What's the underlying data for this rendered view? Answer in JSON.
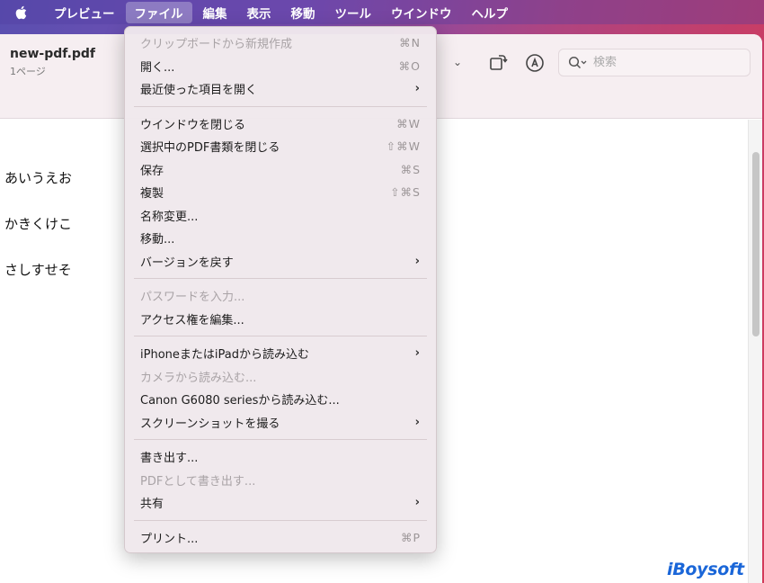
{
  "menubar": {
    "app_name": "プレビュー",
    "items": [
      "ファイル",
      "編集",
      "表示",
      "移動",
      "ツール",
      "ウインドウ",
      "ヘルプ"
    ],
    "active_index": 0
  },
  "window": {
    "doc_title": "new-pdf.pdf",
    "doc_subtitle": "1ページ",
    "search_placeholder": "検索"
  },
  "content": {
    "lines": [
      "あいうえお",
      "かきくけこ",
      "さしすせそ"
    ]
  },
  "file_menu": {
    "groups": [
      [
        {
          "label": "クリップボードから新規作成",
          "shortcut": "⌘N",
          "disabled": true
        },
        {
          "label": "開く...",
          "shortcut": "⌘O"
        },
        {
          "label": "最近使った項目を開く",
          "submenu": true
        }
      ],
      [
        {
          "label": "ウインドウを閉じる",
          "shortcut": "⌘W"
        },
        {
          "label": "選択中のPDF書類を閉じる",
          "shortcut": "⇧⌘W"
        },
        {
          "label": "保存",
          "shortcut": "⌘S"
        },
        {
          "label": "複製",
          "shortcut": "⇧⌘S"
        },
        {
          "label": "名称変更..."
        },
        {
          "label": "移動..."
        },
        {
          "label": "バージョンを戻す",
          "submenu": true
        }
      ],
      [
        {
          "label": "パスワードを入力...",
          "disabled": true
        },
        {
          "label": "アクセス権を編集..."
        }
      ],
      [
        {
          "label": "iPhoneまたはiPadから読み込む",
          "submenu": true
        },
        {
          "label": "カメラから読み込む...",
          "disabled": true
        },
        {
          "label": "Canon G6080 seriesから読み込む..."
        },
        {
          "label": "スクリーンショットを撮る",
          "submenu": true
        }
      ],
      [
        {
          "label": "書き出す..."
        },
        {
          "label": "PDFとして書き出す...",
          "disabled": true
        },
        {
          "label": "共有",
          "submenu": true
        }
      ],
      [
        {
          "label": "プリント...",
          "shortcut": "⌘P"
        }
      ]
    ]
  },
  "watermark": {
    "logo_text": "iBoysoft"
  },
  "colors": {
    "logo": "#1a66d8",
    "menu_bg": "#f0e8ec",
    "disabled_text": "#a9a3a6"
  }
}
